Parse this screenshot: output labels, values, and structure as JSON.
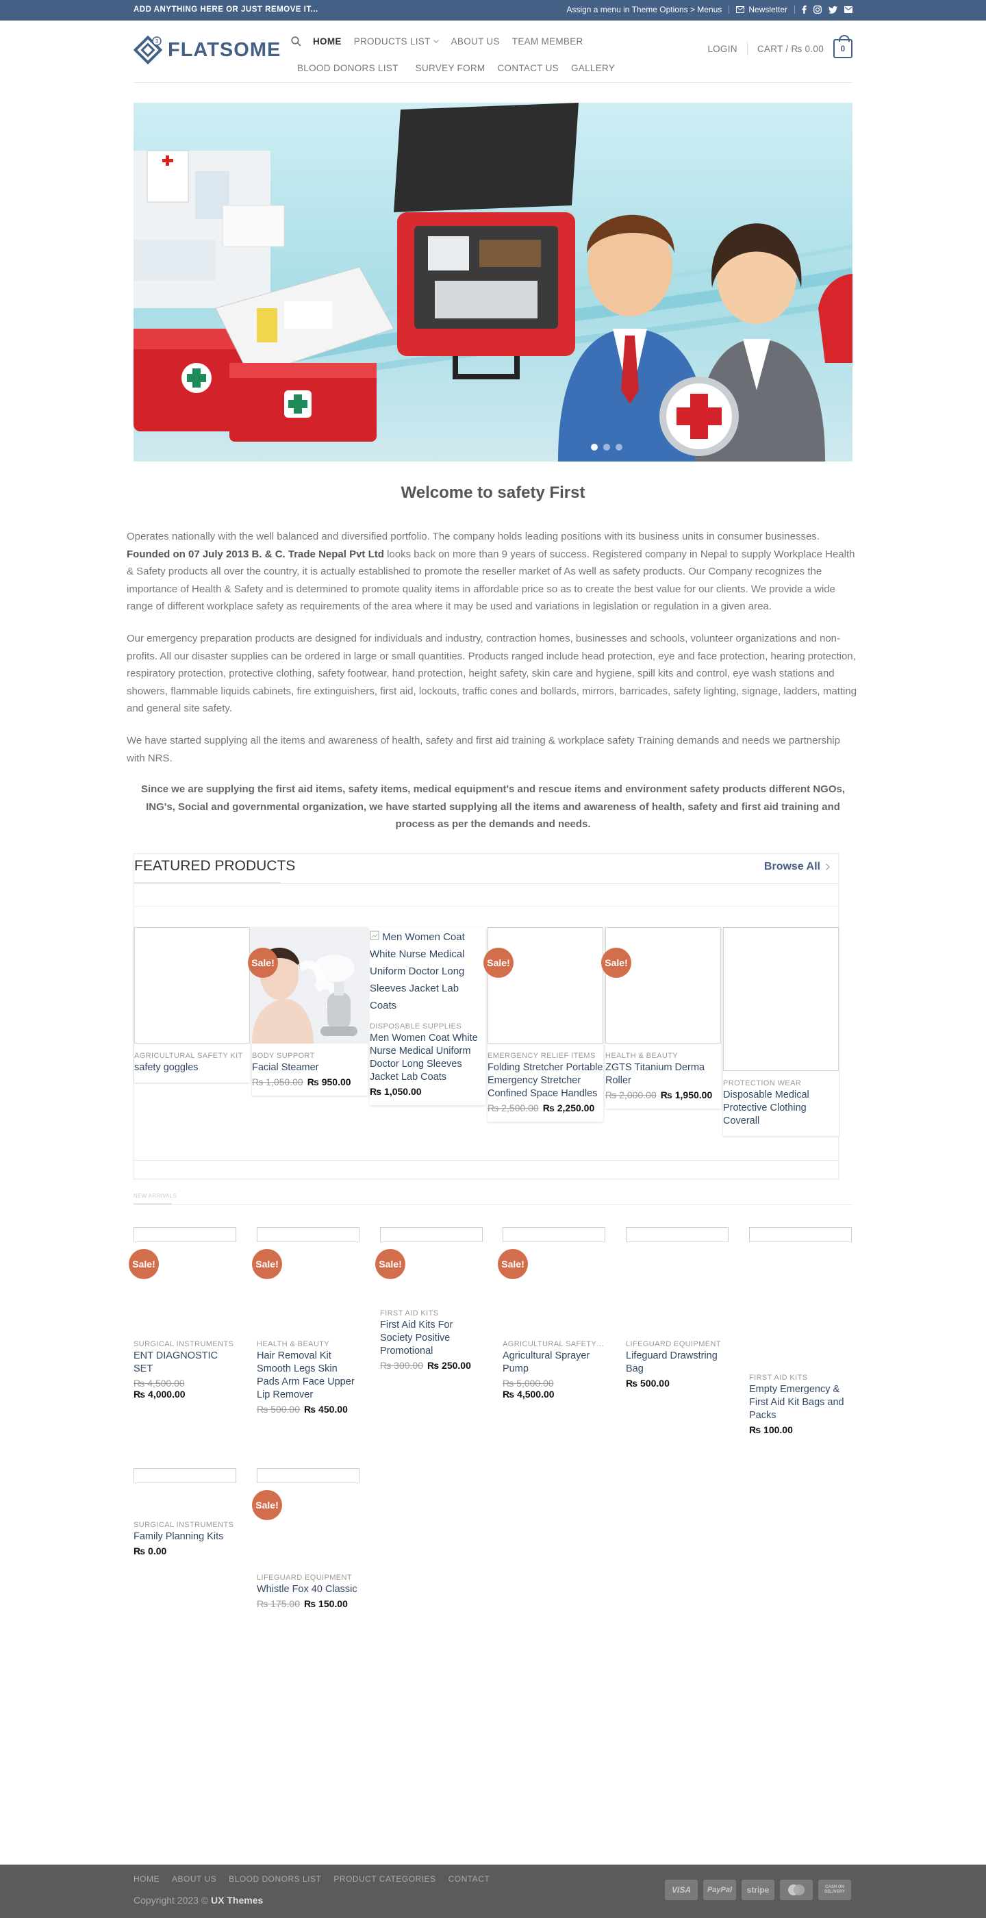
{
  "topbar": {
    "left_text": "ADD ANYTHING HERE OR JUST REMOVE IT...",
    "menu_text": "Assign a menu in Theme Options > Menus",
    "newsletter": "Newsletter"
  },
  "header": {
    "logo_text": "FLATSOME",
    "nav": [
      "HOME",
      "PRODUCTS LIST",
      "ABOUT US",
      "TEAM MEMBER",
      "BLOOD DONORS LIST",
      "SURVEY FORM",
      "CONTACT US",
      "GALLERY"
    ],
    "login": "LOGIN",
    "cart_label": "CART / ₨ 0.00",
    "cart_count": "0"
  },
  "welcome_title": "Welcome to safety First",
  "paragraphs": {
    "p1_a": "Operates nationally with the well balanced and diversified portfolio.  The company holds leading positions with its business units in consumer businesses. ",
    "p1_b": "Founded on 07 July 2013 B. & C. Trade Nepal Pvt Ltd",
    "p1_c": " looks back on more than 9 years of success.  Registered company in Nepal to supply Workplace Health & Safety products all over the country, it is actually established to promote the reseller market of As well as safety products. Our Company recognizes the importance of Health & Safety and is determined to promote quality items in affordable price so as to create the best value for our clients. We provide a wide range of different workplace safety as requirements of the area where it may be used and variations in legislation or regulation in a given area.",
    "p2": "Our emergency preparation products are designed for individuals and industry, contraction homes, businesses and schools, volunteer organizations and non-profits. All our disaster supplies can be ordered in large or small quantities. Products ranged include head protection, eye and face protection, hearing protection, respiratory protection, protective clothing, safety footwear, hand protection, height safety, skin care and hygiene, spill kits and control, eye wash stations and showers, flammable liquids cabinets, fire extinguishers, first aid, lockouts, traffic cones and bollards, mirrors, barricades, safety lighting, signage, ladders, matting and general site safety.",
    "p3": "We have started supplying all the items and awareness of health, safety and first aid training & workplace safety Training demands and needs we partnership with NRS.",
    "p4": "Since we are supplying the first aid items, safety items, medical equipment's and rescue items and environment safety products different NGOs, ING's, Social and governmental organization, we have started supplying all the items and awareness of health, safety and first aid training and process as per the demands and needs."
  },
  "featured": {
    "title": "FEATURED PRODUCTS",
    "browse_all": "Browse All",
    "sale_label": "Sale!",
    "products": [
      {
        "category": "AGRICULTURAL SAFETY KIT",
        "name": "safety goggles",
        "old_price": "",
        "price": ""
      },
      {
        "category": "BODY SUPPORT",
        "name": "Facial Steamer",
        "old_price": "₨ 1,050.00",
        "price": "₨ 950.00"
      },
      {
        "category": "DISPOSABLE SUPPLIES",
        "name": "Men Women Coat White Nurse Medical Uniform Doctor Long Sleeves Jacket Lab Coats",
        "old_price": "",
        "price": "₨ 1,050.00",
        "alt": "Men Women Coat White Nurse Medical Uniform Doctor Long Sleeves Jacket Lab Coats"
      },
      {
        "category": "EMERGENCY RELIEF ITEMS",
        "name": "Folding Stretcher Portable Emergency Stretcher Confined Space Handles",
        "old_price": "₨ 2,500.00",
        "price": "₨ 2,250.00"
      },
      {
        "category": "HEALTH & BEAUTY",
        "name": "ZGTS Titanium Derma Roller",
        "old_price": "₨ 2,000.00",
        "price": "₨ 1,950.00"
      },
      {
        "category": "PROTECTION WEAR",
        "name": "Disposable Medical Protective Clothing Coverall",
        "old_price": "",
        "price": ""
      }
    ]
  },
  "section_tiny_title": "NEW ARRIVALS",
  "grid_products": [
    {
      "category": "SURGICAL INSTRUMENTS",
      "name": "ENT DIAGNOSTIC SET",
      "old_price": "₨ 4,500.00",
      "price": "₨ 4,000.00"
    },
    {
      "category": "HEALTH & BEAUTY",
      "name": "Hair Removal Kit Smooth Legs Skin Pads Arm Face Upper Lip Remover",
      "old_price": "₨ 500.00",
      "price": "₨ 450.00"
    },
    {
      "category": "FIRST AID KITS",
      "name": "First Aid Kits For Society Positive Promotional",
      "old_price": "₨ 300.00",
      "price": "₨ 250.00"
    },
    {
      "category": "AGRICULTURAL SAFETY K...",
      "name": "Agricultural Sprayer Pump",
      "old_price": "₨ 5,000.00",
      "price": "₨ 4,500.00"
    },
    {
      "category": "LIFEGUARD EQUIPMENT",
      "name": "Lifeguard Drawstring Bag",
      "old_price": "",
      "price": "₨ 500.00"
    },
    {
      "category": "FIRST AID KITS",
      "name": "Empty Emergency & First Aid Kit Bags and Packs",
      "old_price": "",
      "price": "₨ 100.00"
    },
    {
      "category": "SURGICAL INSTRUMENTS",
      "name": "Family Planning Kits",
      "old_price": "",
      "price": "₨ 0.00"
    },
    {
      "category": "LIFEGUARD EQUIPMENT",
      "name": "Whistle Fox 40 Classic",
      "old_price": "₨ 175.00",
      "price": "₨ 150.00"
    }
  ],
  "footer": {
    "nav": [
      "HOME",
      "ABOUT US",
      "BLOOD DONORS LIST",
      "PRODUCT CATEGORIES",
      "CONTACT"
    ],
    "copyright": "Copyright 2023 © ",
    "copyright_brand": "UX Themes",
    "payments": [
      "VISA",
      "PayPal",
      "stripe",
      "MasterCard",
      "CASH ON DELIVERY"
    ]
  },
  "colors": {
    "primary": "#446084",
    "sale": "#d26e4b",
    "footer": "#5b5b5b"
  }
}
